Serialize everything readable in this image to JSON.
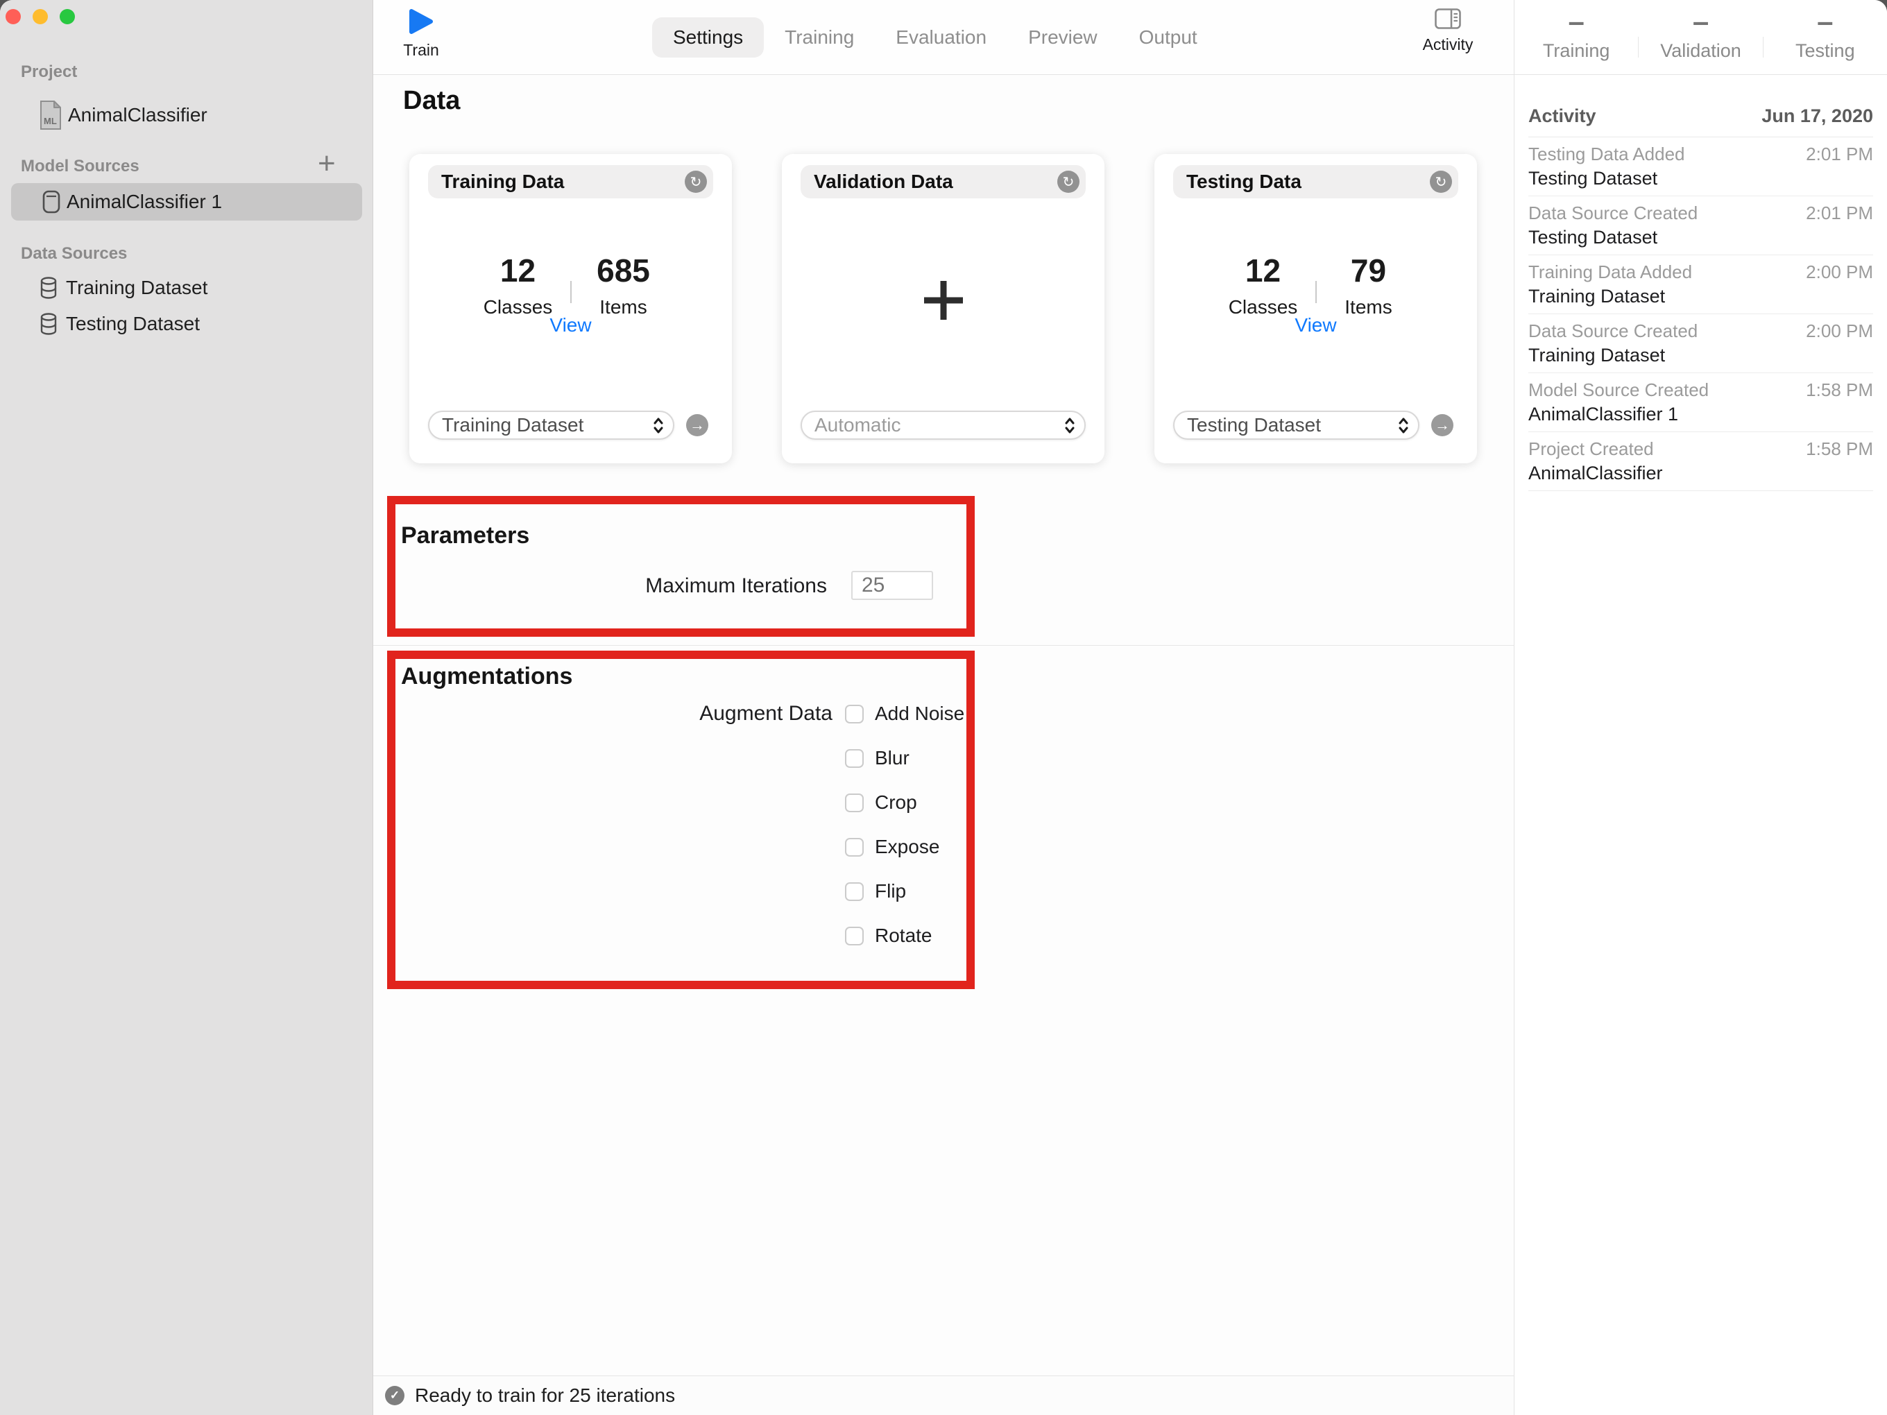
{
  "colors": {
    "annotation_red": "#e1241d",
    "accent_blue": "#1779f3",
    "link_blue": "#0f79fe",
    "traffic_red": "#ff5f57",
    "traffic_yellow": "#febc2e",
    "traffic_green": "#28c840",
    "sidebar_bg": "#e2e1e1",
    "selected_row_bg": "#c8c7c7"
  },
  "sidebar": {
    "sections": [
      {
        "title": "Project",
        "items": [
          {
            "label": "AnimalClassifier",
            "icon": "ml-document-icon",
            "icon_text": "ML"
          }
        ]
      },
      {
        "title": "Model Sources",
        "action_label": "+",
        "items": [
          {
            "label": "AnimalClassifier 1",
            "icon": "model-icon",
            "selected": true
          }
        ]
      },
      {
        "title": "Data Sources",
        "items": [
          {
            "label": "Training Dataset",
            "icon": "database-icon"
          },
          {
            "label": "Testing Dataset",
            "icon": "database-icon"
          }
        ]
      }
    ]
  },
  "toolbar": {
    "train_label": "Train",
    "tabs": [
      {
        "label": "Settings",
        "selected": true
      },
      {
        "label": "Training",
        "selected": false
      },
      {
        "label": "Evaluation",
        "selected": false
      },
      {
        "label": "Preview",
        "selected": false
      },
      {
        "label": "Output",
        "selected": false
      }
    ],
    "activity_label": "Activity"
  },
  "status_columns": [
    {
      "value": "–",
      "label": "Training"
    },
    {
      "value": "–",
      "label": "Validation"
    },
    {
      "value": "–",
      "label": "Testing"
    }
  ],
  "activity_panel": {
    "title": "Activity",
    "date": "Jun 17, 2020",
    "entries": [
      {
        "title": "Testing Data Added",
        "time": "2:01 PM",
        "subtitle": "Testing Dataset"
      },
      {
        "title": "Data Source Created",
        "time": "2:01 PM",
        "subtitle": "Testing Dataset"
      },
      {
        "title": "Training Data Added",
        "time": "2:00 PM",
        "subtitle": "Training Dataset"
      },
      {
        "title": "Data Source Created",
        "time": "2:00 PM",
        "subtitle": "Training Dataset"
      },
      {
        "title": "Model Source Created",
        "time": "1:58 PM",
        "subtitle": "AnimalClassifier 1"
      },
      {
        "title": "Project Created",
        "time": "1:58 PM",
        "subtitle": "AnimalClassifier"
      }
    ]
  },
  "data_section": {
    "heading": "Data",
    "cards": [
      {
        "title": "Training Data",
        "classes_value": "12",
        "classes_label": "Classes",
        "items_value": "685",
        "items_label": "Items",
        "view_label": "View",
        "dataset_value": "Training Dataset"
      },
      {
        "title": "Validation Data",
        "empty_icon": "plus-icon",
        "dataset_value": "Automatic"
      },
      {
        "title": "Testing Data",
        "classes_value": "12",
        "classes_label": "Classes",
        "items_value": "79",
        "items_label": "Items",
        "view_label": "View",
        "dataset_value": "Testing Dataset"
      }
    ]
  },
  "parameters": {
    "heading": "Parameters",
    "max_iterations_label": "Maximum Iterations",
    "max_iterations_value": "25"
  },
  "augmentations": {
    "heading": "Augmentations",
    "augment_label": "Augment Data",
    "options": [
      "Add Noise",
      "Blur",
      "Crop",
      "Expose",
      "Flip",
      "Rotate"
    ]
  },
  "status_bar": {
    "message": "Ready to train for 25 iterations"
  }
}
